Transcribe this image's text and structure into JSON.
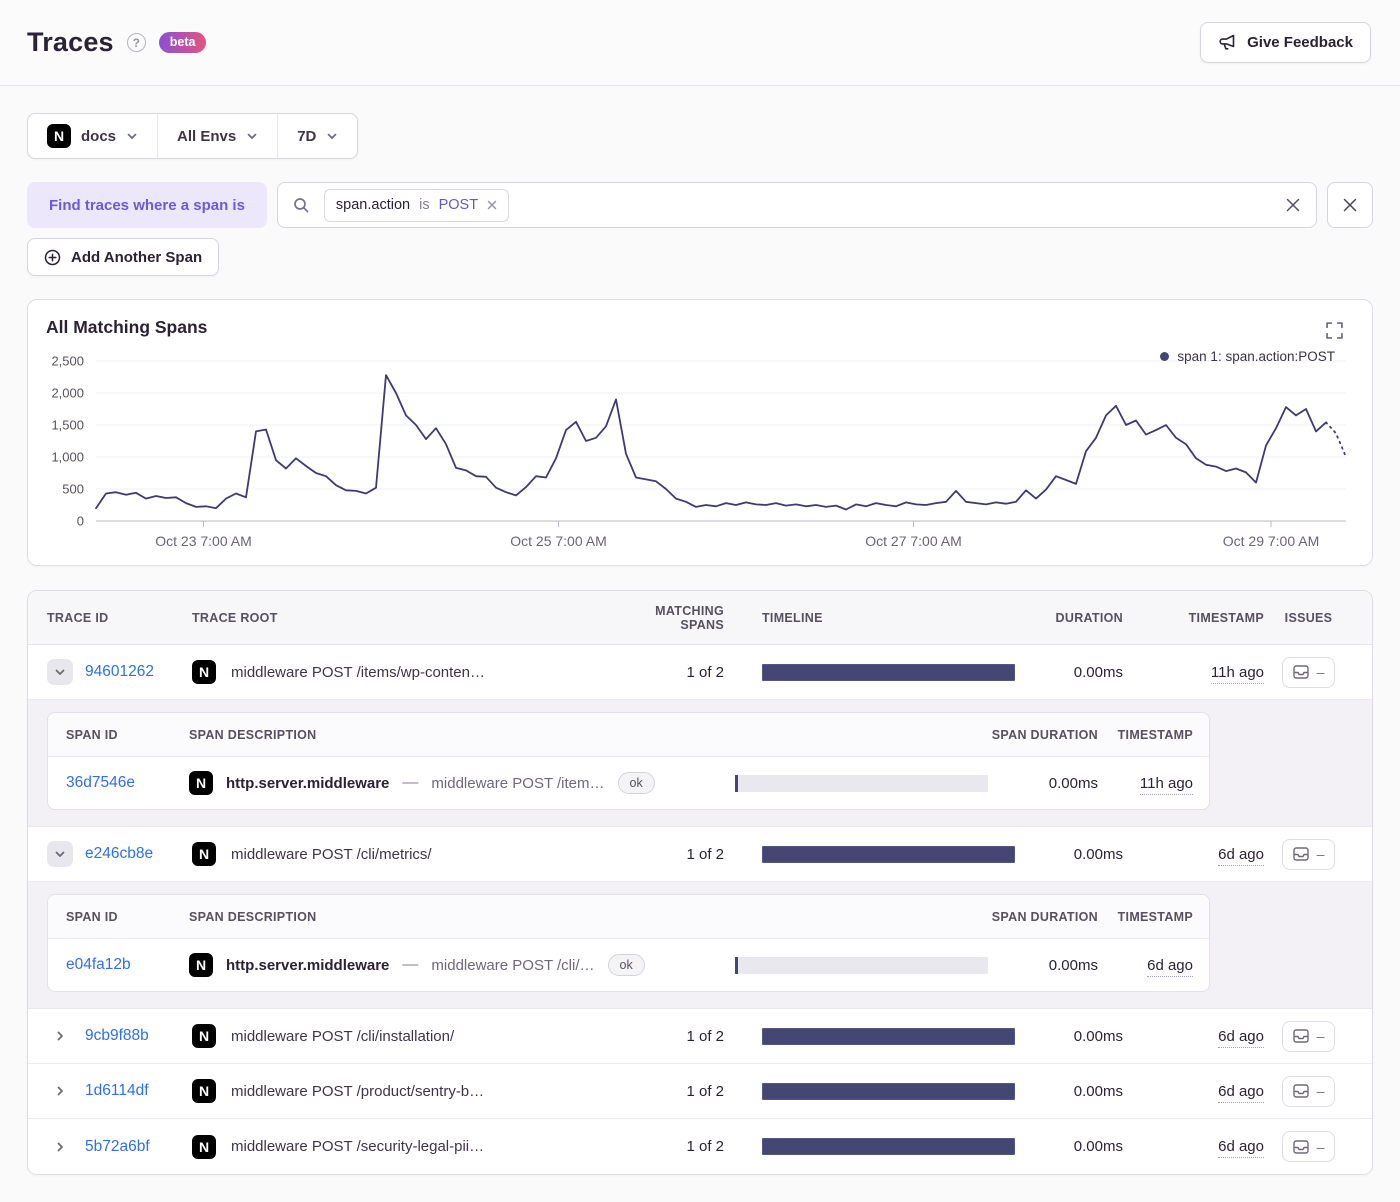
{
  "header": {
    "title": "Traces",
    "beta_label": "beta",
    "feedback_label": "Give Feedback"
  },
  "filters": {
    "project": {
      "label": "docs"
    },
    "environment": {
      "label": "All Envs"
    },
    "period": {
      "label": "7D"
    }
  },
  "icons": {
    "nextjs_letter": "N"
  },
  "query": {
    "find_label": "Find traces where a span is",
    "token": {
      "key": "span.action",
      "operator": "is",
      "value": "POST"
    },
    "add_span_label": "Add Another Span"
  },
  "chart_data": {
    "type": "line",
    "title": "All Matching Spans",
    "xlabel": "",
    "ylabel": "",
    "ylim": [
      0,
      2500
    ],
    "grid": true,
    "legend_position": "top-right",
    "line_color": "#3E3A73",
    "dashed_tail_points": 3,
    "legend": [
      {
        "label": "span 1: span.action:POST",
        "color": "#444674"
      }
    ],
    "y_ticks": [
      {
        "value": 0,
        "label": "0"
      },
      {
        "value": 500,
        "label": "500"
      },
      {
        "value": 1000,
        "label": "1,000"
      },
      {
        "value": 1500,
        "label": "1,500"
      },
      {
        "value": 2000,
        "label": "2,000"
      },
      {
        "value": 2500,
        "label": "2,500"
      }
    ],
    "x_ticks": [
      {
        "label": "Oct 23 7:00 AM",
        "pos": 0.086
      },
      {
        "label": "Oct 25 7:00 AM",
        "pos": 0.37
      },
      {
        "label": "Oct 27 7:00 AM",
        "pos": 0.654
      },
      {
        "label": "Oct 29 7:00 AM",
        "pos": 0.94
      }
    ],
    "series": [
      {
        "name": "span 1: span.action:POST",
        "values": [
          200,
          430,
          450,
          410,
          440,
          350,
          390,
          360,
          370,
          280,
          220,
          230,
          200,
          350,
          430,
          370,
          1400,
          1430,
          950,
          820,
          980,
          860,
          750,
          700,
          560,
          480,
          470,
          430,
          520,
          2280,
          2000,
          1650,
          1500,
          1280,
          1450,
          1200,
          830,
          790,
          700,
          690,
          520,
          450,
          400,
          530,
          700,
          680,
          980,
          1420,
          1550,
          1250,
          1300,
          1480,
          1900,
          1050,
          680,
          650,
          620,
          500,
          350,
          300,
          220,
          250,
          230,
          280,
          250,
          290,
          260,
          250,
          280,
          240,
          260,
          230,
          250,
          220,
          240,
          180,
          260,
          230,
          280,
          250,
          230,
          290,
          260,
          250,
          280,
          300,
          470,
          300,
          280,
          260,
          290,
          270,
          300,
          480,
          350,
          490,
          700,
          640,
          580,
          1090,
          1300,
          1650,
          1800,
          1500,
          1570,
          1350,
          1420,
          1500,
          1300,
          1200,
          980,
          880,
          850,
          780,
          820,
          760,
          600,
          1180,
          1450,
          1780,
          1650,
          1750,
          1400,
          1540,
          1370,
          1000
        ]
      }
    ]
  },
  "table": {
    "columns": [
      "TRACE ID",
      "TRACE ROOT",
      "MATCHING SPANS",
      "TIMELINE",
      "DURATION",
      "TIMESTAMP",
      "ISSUES"
    ],
    "span_columns": [
      "SPAN ID",
      "SPAN DESCRIPTION",
      "SPAN DURATION",
      "TIMESTAMP"
    ],
    "issues_dash": "–",
    "rows": [
      {
        "trace_id": "94601262",
        "expanded": true,
        "root": "middleware POST /items/wp-conten…",
        "matching_spans": "1 of 2",
        "duration": "0.00ms",
        "timestamp": "11h ago",
        "spans": [
          {
            "span_id": "36d7546e",
            "operation": "http.server.middleware",
            "separator": "—",
            "description": "middleware POST /item…",
            "status": "ok",
            "duration": "0.00ms",
            "timestamp": "11h ago"
          }
        ]
      },
      {
        "trace_id": "e246cb8e",
        "expanded": true,
        "root": "middleware POST /cli/metrics/",
        "matching_spans": "1 of 2",
        "duration": "0.00ms",
        "timestamp": "6d ago",
        "spans": [
          {
            "span_id": "e04fa12b",
            "operation": "http.server.middleware",
            "separator": "—",
            "description": "middleware POST /cli/…",
            "status": "ok",
            "duration": "0.00ms",
            "timestamp": "6d ago"
          }
        ]
      },
      {
        "trace_id": "9cb9f88b",
        "expanded": false,
        "root": "middleware POST /cli/installation/",
        "matching_spans": "1 of 2",
        "duration": "0.00ms",
        "timestamp": "6d ago",
        "spans": []
      },
      {
        "trace_id": "1d6114df",
        "expanded": false,
        "root": "middleware POST /product/sentry-b…",
        "matching_spans": "1 of 2",
        "duration": "0.00ms",
        "timestamp": "6d ago",
        "spans": []
      },
      {
        "trace_id": "5b72a6bf",
        "expanded": false,
        "root": "middleware POST /security-legal-pii…",
        "matching_spans": "1 of 2",
        "duration": "0.00ms",
        "timestamp": "6d ago",
        "spans": []
      }
    ]
  },
  "colors": {
    "accent_purple": "#6C5FC7",
    "link_blue": "#2F6FE8",
    "chart_line": "#3E3A73",
    "timeline_bar": "#444674",
    "beta_gradient_start": "#8A4FD8",
    "beta_gradient_end": "#E4567B"
  }
}
